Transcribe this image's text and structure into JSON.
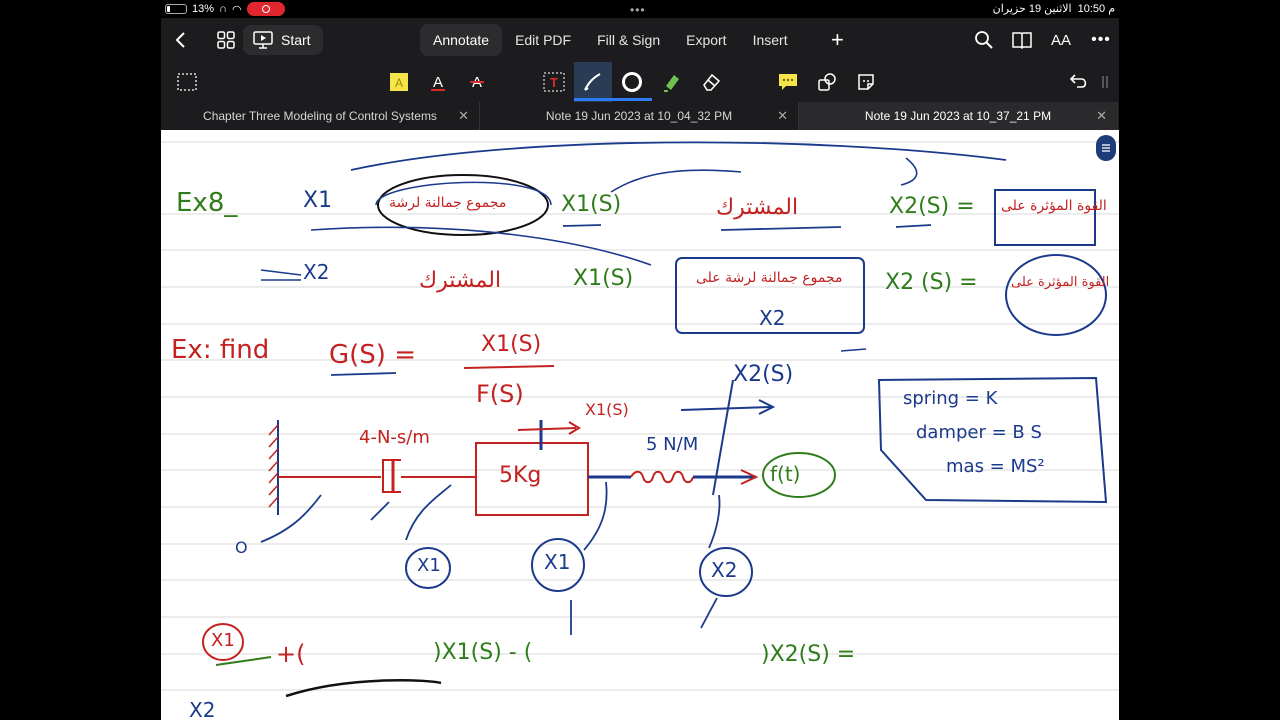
{
  "status_bar": {
    "battery": "13%",
    "time": "10:50 م",
    "date": "الاثنين 19 حزيران"
  },
  "nav": {
    "start_label": "Start",
    "tabs": [
      "Annotate",
      "Edit PDF",
      "Fill & Sign",
      "Export",
      "Insert"
    ],
    "active_tab": "Annotate",
    "font_size_label": "AA"
  },
  "toolbar": {
    "colors": {
      "highlight": "#f5e54a",
      "text_red": "#d92b2b",
      "accent_blue": "#2f7bf6",
      "pen_active_bg": "#2a3b55"
    }
  },
  "doc_tabs": [
    {
      "title": "Chapter Three Modeling of Control Systems"
    },
    {
      "title": "Note 19 Jun 2023 at 10_04_32 PM"
    },
    {
      "title": "Note 19 Jun 2023 at 10_37_21 PM"
    }
  ],
  "note": {
    "ex_label": "Ex8_",
    "eq1_x1": "X1",
    "eq1_x1s": "X1(S)",
    "eq1_arabic_sum": "مجموع جمالنة لرشة",
    "eq1_arabic_common": "المشترك",
    "eq1_x2s": "X2(S) =",
    "eq1_arabic_force": "القوة المؤثرة على",
    "eq2_x2": "X2",
    "eq2_arabic_common": "المشترك",
    "eq2_x1s": "X1(S)",
    "eq2_arabic_sum": "مجموع جمالنة لرشة على",
    "eq2_box_x2": "X2",
    "eq2_x2s": "X2 (S) =",
    "eq2_arabic_force": "القوة المؤثرة على",
    "ex_find": "Ex: find",
    "gs": "G(S) =",
    "gs_num": "X1(S)",
    "gs_den": "F(S)",
    "x2s_top": "X2(S)",
    "x1s_top": "X1(S)",
    "damper_label": "4-N-s/m",
    "spring_label": "5 N/M",
    "mass_label": "5Kg",
    "force_label": "f(t)",
    "legend_spring": "spring = K",
    "legend_damper": "damper = B S",
    "legend_mass": "mas = MS²",
    "circ_x1a": "X1",
    "circ_x1b": "X1",
    "circ_x2": "X2",
    "circ_o": "O",
    "bot_x1": "X1",
    "bot_plus": "+(",
    "bot_x1s": ")X1(S) - (",
    "bot_x2s": ")X2(S) =",
    "bot_x2_partial": "X2"
  }
}
